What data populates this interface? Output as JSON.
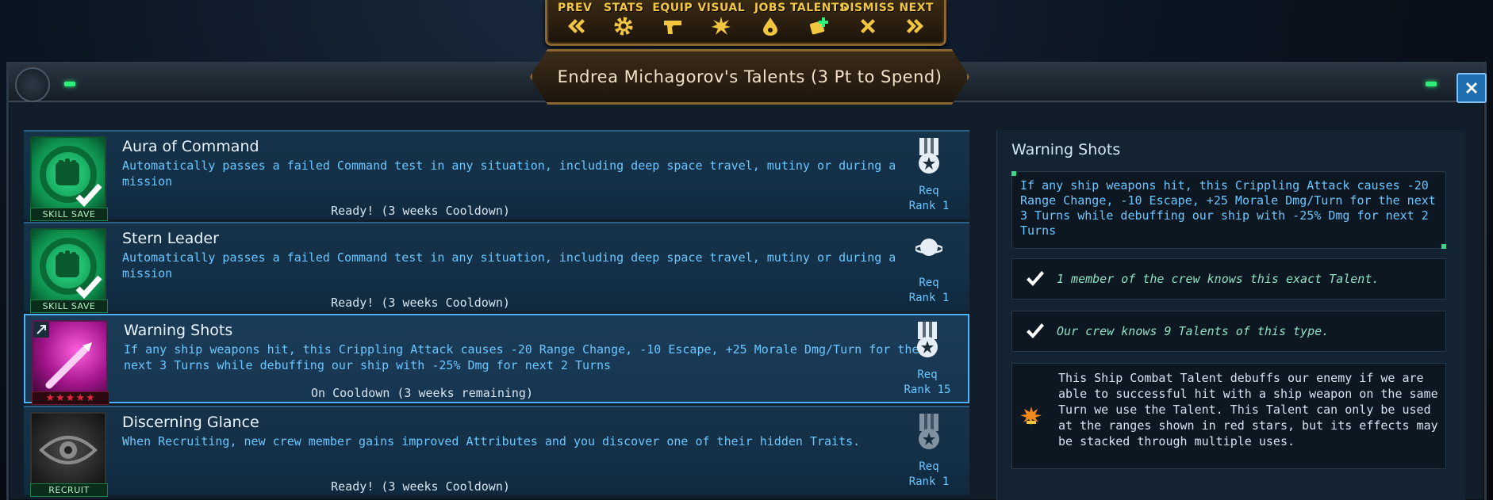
{
  "commands": [
    {
      "label": "PREV",
      "icon": "double-chevron-left-icon"
    },
    {
      "label": "STATS",
      "icon": "gear-icon"
    },
    {
      "label": "EQUIP",
      "icon": "pistol-icon"
    },
    {
      "label": "VISUAL",
      "icon": "burst-icon"
    },
    {
      "label": "JOBS",
      "icon": "drop-icon"
    },
    {
      "label": "TALENTS",
      "icon": "talent-card-icon"
    },
    {
      "label": "DISMISS",
      "icon": "x-icon"
    },
    {
      "label": "NEXT",
      "icon": "double-chevron-right-icon"
    }
  ],
  "window": {
    "title": "Endrea Michagorov's Talents (3 Pt to Spend)",
    "close_icon": "close-icon"
  },
  "talents": [
    {
      "name": "Aura of Command",
      "description": "Automatically passes a failed Command test in any situation, including deep space travel, mutiny or during a mission",
      "status": "Ready! (3 weeks Cooldown)",
      "icon_label": "SKILL SAVE",
      "icon": "fist-icon",
      "req_icon": "rank-medal-icon",
      "req_label": "Req",
      "req_value": "Rank 1"
    },
    {
      "name": "Stern Leader",
      "description": "Automatically passes a failed Command test in any situation, including deep space travel, mutiny or during a mission",
      "status": "Ready! (3 weeks Cooldown)",
      "icon_label": "SKILL SAVE",
      "icon": "fist-icon",
      "req_icon": "planet-icon",
      "req_label": "Req",
      "req_value": "Rank 1"
    },
    {
      "name": "Warning Shots",
      "description": "If any ship weapons hit, this Crippling Attack causes -20 Range Change, -10 Escape, +25 Morale Dmg/Turn for the next 3 Turns while debuffing our ship with -25% Dmg for next 2 Turns",
      "status": "On Cooldown (3 weeks remaining)",
      "icon_label": "★★★★★",
      "icon": "missile-icon",
      "req_icon": "rank-medal-icon",
      "req_label": "Req",
      "req_value": "Rank 15"
    },
    {
      "name": "Discerning Glance",
      "description": "When Recruiting, new crew member gains improved Attributes and you discover one of their hidden Traits.",
      "status": "Ready! (3 weeks Cooldown)",
      "icon_label": "RECRUIT",
      "icon": "eye-icon",
      "req_icon": "rank-medal-icon",
      "req_label": "Req",
      "req_value": "Rank 1"
    }
  ],
  "detail": {
    "title": "Warning Shots",
    "description": "If any ship weapons hit, this Crippling Attack causes -20 Range Change, -10 Escape, +25 Morale Dmg/Turn for the next 3 Turns while debuffing our ship with -25% Dmg for next 2 Turns",
    "fact1": "1 member of the crew knows this exact Talent.",
    "fact2": "Our crew knows 9 Talents of this type.",
    "info": "This Ship Combat Talent debuffs our enemy if we are able to successful hit with a ship weapon on the same Turn we use the Talent. This Talent can only be used at the ranges shown in red stars, but its effects may be stacked through multiple uses."
  },
  "colors": {
    "accent": "#6bc6ff",
    "gold": "#f3c640",
    "green": "#2df07a",
    "star_red": "#e0283a"
  }
}
